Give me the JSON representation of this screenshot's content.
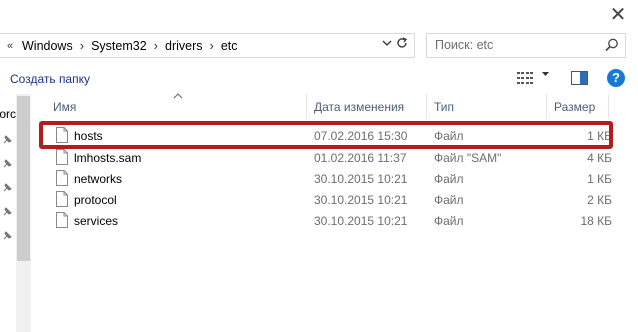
{
  "window": {
    "close_glyph": "✕"
  },
  "address": {
    "overflow_glyph": "«",
    "crumbs": [
      "Windows",
      "System32",
      "drivers",
      "etc"
    ],
    "separator": "›"
  },
  "search": {
    "placeholder": "Поиск: etc"
  },
  "toolbar": {
    "new_folder_label": "Создать папку"
  },
  "help": {
    "label": "?"
  },
  "nav": {
    "partial_label": "orc"
  },
  "columns": {
    "name": "Имя",
    "date": "Дата изменения",
    "type": "Тип",
    "size": "Размер"
  },
  "files": [
    {
      "name": "hosts",
      "date": "07.02.2016 15:30",
      "type": "Файл",
      "size": "1 КБ",
      "highlighted": true
    },
    {
      "name": "lmhosts.sam",
      "date": "01.02.2016 11:37",
      "type": "Файл \"SAM\"",
      "size": "4 КБ"
    },
    {
      "name": "networks",
      "date": "30.10.2015 10:21",
      "type": "Файл",
      "size": "1 КБ"
    },
    {
      "name": "protocol",
      "date": "30.10.2015 10:21",
      "type": "Файл",
      "size": "2 КБ"
    },
    {
      "name": "services",
      "date": "30.10.2015 10:21",
      "type": "Файл",
      "size": "18 КБ"
    }
  ],
  "colors": {
    "highlight_border": "#b51c1c",
    "link": "#1e3287",
    "help_blue": "#1779d4",
    "header_text": "#4c607a"
  },
  "icons": [
    "close-icon",
    "chevron-down-icon",
    "refresh-icon",
    "search-icon",
    "view-options-icon",
    "preview-pane-icon",
    "help-icon",
    "pin-icon",
    "file-icon",
    "sort-up-icon"
  ]
}
